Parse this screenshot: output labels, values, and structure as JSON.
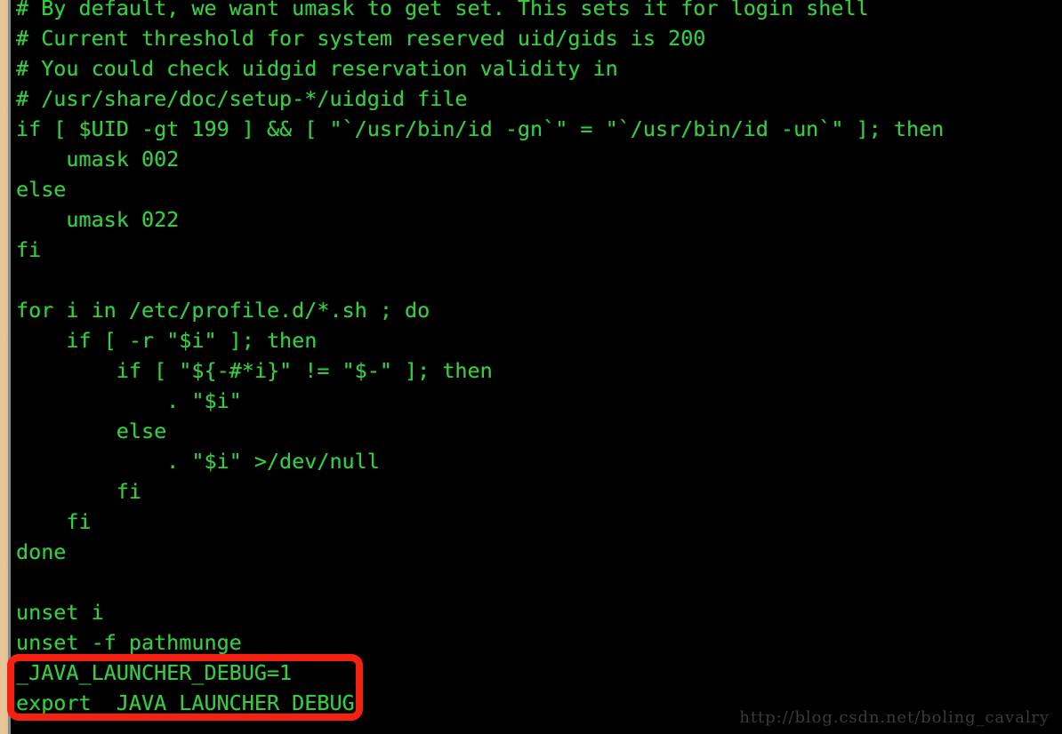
{
  "terminal": {
    "background_color": "#000000",
    "text_color": "#35cc40",
    "lines": [
      "# By default, we want umask to get set. This sets it for login shell",
      "# Current threshold for system reserved uid/gids is 200",
      "# You could check uidgid reservation validity in",
      "# /usr/share/doc/setup-*/uidgid file",
      "if [ $UID -gt 199 ] && [ \"`/usr/bin/id -gn`\" = \"`/usr/bin/id -un`\" ]; then",
      "    umask 002",
      "else",
      "    umask 022",
      "fi",
      "",
      "for i in /etc/profile.d/*.sh ; do",
      "    if [ -r \"$i\" ]; then",
      "        if [ \"${-#*i}\" != \"$-\" ]; then",
      "            . \"$i\"",
      "        else",
      "            . \"$i\" >/dev/null",
      "        fi",
      "    fi",
      "done",
      "",
      "unset i",
      "unset -f pathmunge",
      "_JAVA_LAUNCHER_DEBUG=1",
      "export _JAVA_LAUNCHER_DEBUG"
    ]
  },
  "annotation": {
    "highlight_color": "#f42112",
    "highlighted_lines": [
      "_JAVA_LAUNCHER_DEBUG=1",
      "export _JAVA_LAUNCHER_DEBUG"
    ]
  },
  "watermark": {
    "text": "http://blog.csdn.net/boling_cavalry",
    "color": "#3b3b3b"
  },
  "gutter": {
    "strip_color": "#e8c496",
    "divider_color": "#8a8a8a"
  }
}
